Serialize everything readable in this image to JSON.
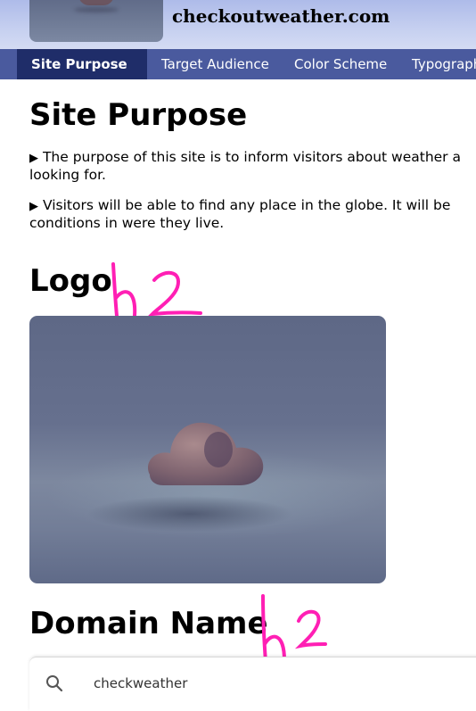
{
  "header": {
    "site_name": "checkoutweather.com"
  },
  "nav": {
    "items": [
      {
        "label": "Site Purpose",
        "active": true
      },
      {
        "label": "Target Audience",
        "active": false
      },
      {
        "label": "Color Scheme",
        "active": false
      },
      {
        "label": "Typography",
        "active": false
      }
    ]
  },
  "main": {
    "title": "Site Purpose",
    "paragraphs": [
      "The purpose of this site is to inform visitors about weather and looking for.",
      "Visitors will be able to find any place in the globe. It will be conditions in were they live."
    ],
    "paragraph_lines": [
      [
        "The purpose of this site is to inform visitors about weather a",
        "looking for."
      ],
      [
        "Visitors will be able to find any place in the globe. It will be",
        "conditions in were they live."
      ]
    ],
    "logo_heading": "Logo",
    "logo_annotation": "h2",
    "domain_heading": "Domain Name",
    "domain_annotation": "h2"
  },
  "search": {
    "value": "checkweather"
  },
  "colors": {
    "nav_bg": "#4a5a9e",
    "nav_active_bg": "#1f2d69",
    "annotation": "#ff1fb4"
  }
}
